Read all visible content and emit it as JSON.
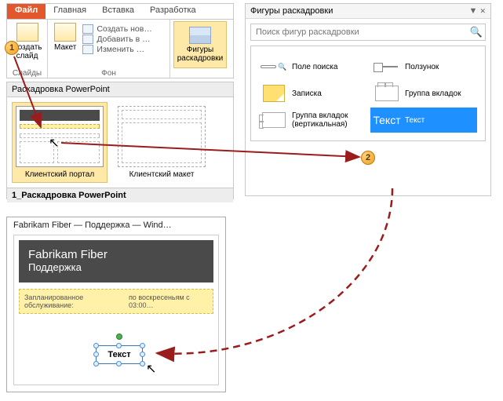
{
  "ribbon": {
    "tabs": {
      "file": "Файл",
      "home": "Главная",
      "insert": "Вставка",
      "dev": "Разработка"
    },
    "new_slide": "Создать\nслайд",
    "group_slides": "Слайды",
    "layout": "Макет",
    "bg": {
      "create": "Создать нов…",
      "add": "Добавить в …",
      "edit": "Изменить …"
    },
    "group_bg": "Фон",
    "shapes_btn": "Фигуры\nраскадровки"
  },
  "storyboard": {
    "title": "Раскадровка PowerPoint",
    "item1": "Клиентский портал",
    "item2": "Клиентский макет",
    "footer": "1_Раскадровка PowerPoint"
  },
  "pane": {
    "title": "Фигуры раскадровки",
    "search_placeholder": "Поиск фигур раскадровки",
    "items": {
      "search": "Поле поиска",
      "slider": "Ползунок",
      "note": "Записка",
      "tabgrp": "Группа вкладок",
      "tabgrp_v": "Группа вкладок (вертикальная)",
      "text": "Текст",
      "text_ico": "Текст"
    }
  },
  "preview": {
    "title": "Fabrikam Fiber — Поддержка — Wind…",
    "h1": "Fabrikam Fiber",
    "h2": "Поддержка",
    "notice_label": "Запланированное обслуживание:",
    "notice_val": "по воскресеньям с 03:00…",
    "shape_text": "Текст"
  },
  "bubbles": {
    "b1": "1",
    "b2": "2"
  }
}
